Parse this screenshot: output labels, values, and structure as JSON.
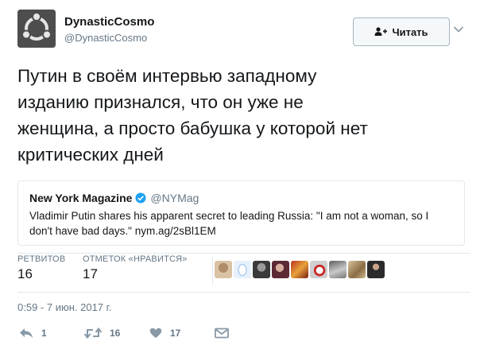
{
  "author": {
    "display_name": "DynasticCosmo",
    "screen_name": "@DynasticCosmo",
    "avatar_icon": "ubuntu-logo-icon"
  },
  "follow_button": {
    "label": "Читать",
    "icon": "add-user-icon"
  },
  "tweet": {
    "lines": [
      "Путин в своём интервью западному",
      "изданию признался, что он уже не",
      "женщина, а просто бабушка у которой нет",
      "критических дней"
    ]
  },
  "quote": {
    "name": "New York Magazine",
    "handle": "@NYMag",
    "lines": [
      "Vladimir Putin shares his apparent secret to leading Russia: \"I am not a woman, so I",
      "don't have bad days.\" nym.ag/2sBl1EM"
    ]
  },
  "stats": {
    "retweets": {
      "label": "РЕТВИТОВ",
      "value": "16"
    },
    "likes": {
      "label": "ОТМЕТОК «НРАВИТСЯ»",
      "value": "17"
    }
  },
  "timestamp": "0:59 - 7 июн. 2017 г.",
  "actions": {
    "reply": {
      "icon": "reply-icon",
      "count": "1"
    },
    "retweet": {
      "icon": "retweet-icon",
      "count": "16"
    },
    "like": {
      "icon": "heart-icon",
      "count": "17"
    },
    "dm": {
      "icon": "envelope-icon"
    }
  },
  "colors": {
    "text": "#14171a",
    "secondary": "#657786",
    "border": "#e1e8ed",
    "verified": "#1da1f2"
  }
}
